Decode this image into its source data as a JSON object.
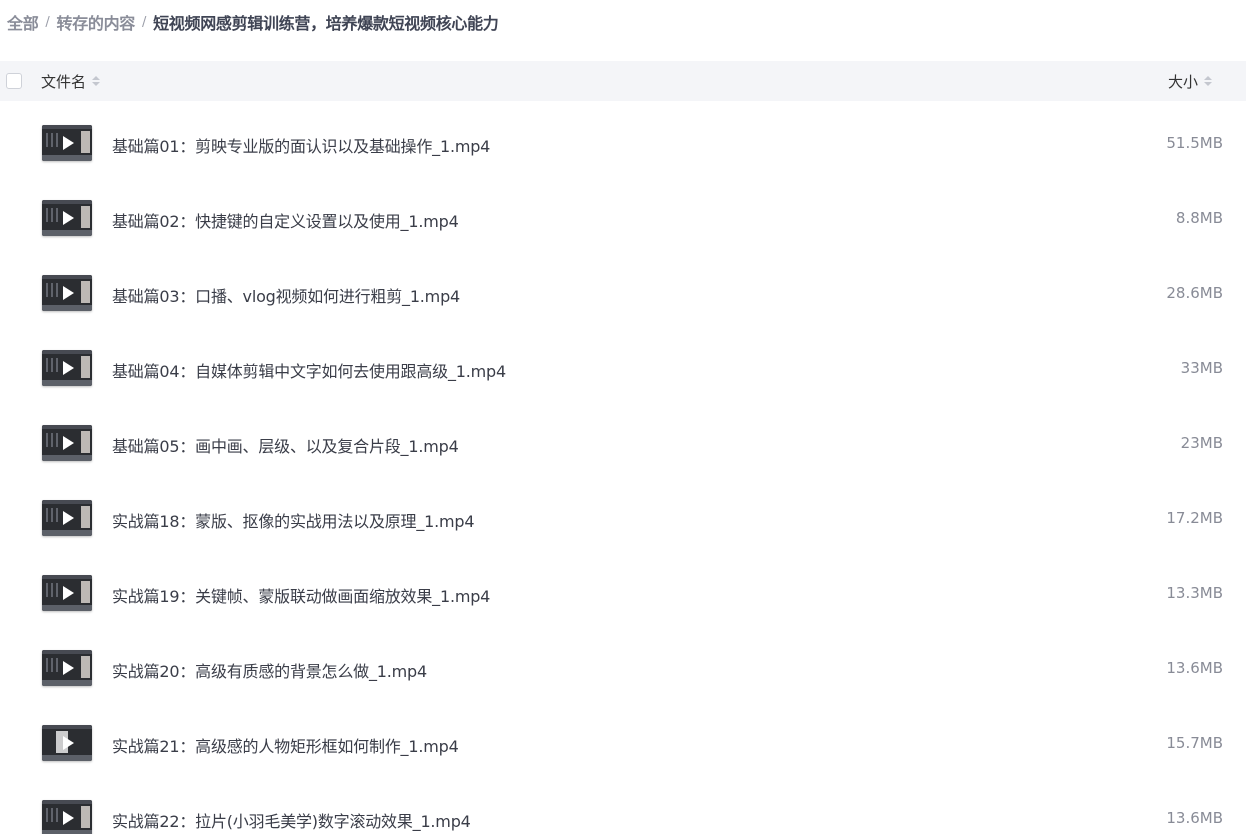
{
  "breadcrumb": {
    "root": "全部",
    "parent": "转存的内容",
    "current": "短视频网感剪辑训练营，培养爆款短视频核心能力",
    "separator": "/"
  },
  "table": {
    "col_name": "文件名",
    "col_size": "大小"
  },
  "files": [
    {
      "name": "基础篇01：剪映专业版的面认识以及基础操作_1.mp4",
      "size": "51.5MB",
      "icon": "video-thumbnail-icon"
    },
    {
      "name": "基础篇02：快捷键的自定义设置以及使用_1.mp4",
      "size": "8.8MB",
      "icon": "video-thumbnail-icon"
    },
    {
      "name": "基础篇03：口播、vlog视频如何进行粗剪_1.mp4",
      "size": "28.6MB",
      "icon": "video-thumbnail-icon"
    },
    {
      "name": "基础篇04：自媒体剪辑中文字如何去使用跟高级_1.mp4",
      "size": "33MB",
      "icon": "video-thumbnail-icon"
    },
    {
      "name": "基础篇05：画中画、层级、以及复合片段_1.mp4",
      "size": "23MB",
      "icon": "video-thumbnail-icon"
    },
    {
      "name": "实战篇18：蒙版、抠像的实战用法以及原理_1.mp4",
      "size": "17.2MB",
      "icon": "video-thumbnail-icon"
    },
    {
      "name": "实战篇19：关键帧、蒙版联动做画面缩放效果_1.mp4",
      "size": "13.3MB",
      "icon": "video-thumbnail-icon"
    },
    {
      "name": "实战篇20：高级有质感的背景怎么做_1.mp4",
      "size": "13.6MB",
      "icon": "video-thumbnail-icon"
    },
    {
      "name": "实战篇21：高级感的人物矩形框如何制作_1.mp4",
      "size": "15.7MB",
      "icon": "video-thumbnail-icon"
    },
    {
      "name": "实战篇22：拉片(小羽毛美学)数字滚动效果_1.mp4",
      "size": "13.6MB",
      "icon": "video-thumbnail-icon"
    }
  ]
}
